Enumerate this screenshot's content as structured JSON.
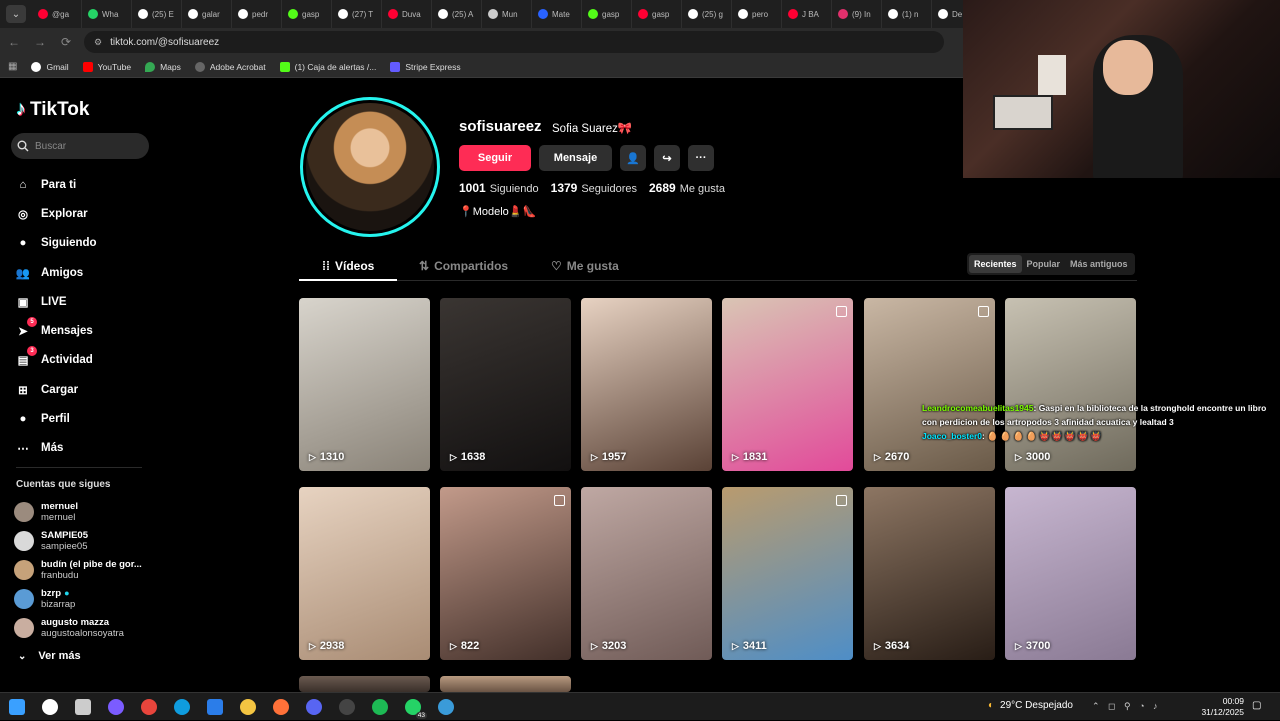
{
  "browser": {
    "tabs": [
      "@ga",
      "Wha",
      "(25) E",
      "galar",
      "pedr",
      "gasp",
      "(27) T",
      "Duva",
      "(25) A",
      "Mun",
      "Mate",
      "gasp",
      "gasp",
      "(25) g",
      "pero",
      "J BA",
      "(9) In",
      "(1) n",
      "De"
    ],
    "url": "tiktok.com/@sofisuareez",
    "bookmarks": [
      "Gmail",
      "YouTube",
      "Maps",
      "Adobe Acrobat",
      "(1) Caja de alertas /...",
      "Stripe Express"
    ]
  },
  "sidebar": {
    "logo": "TikTok",
    "search_placeholder": "Buscar",
    "nav": [
      {
        "label": "Para ti",
        "icon": "home-icon"
      },
      {
        "label": "Explorar",
        "icon": "compass-icon"
      },
      {
        "label": "Siguiendo",
        "icon": "following-icon"
      },
      {
        "label": "Amigos",
        "icon": "friends-icon"
      },
      {
        "label": "LIVE",
        "icon": "live-icon"
      },
      {
        "label": "Mensajes",
        "icon": "messages-icon",
        "badge": "5"
      },
      {
        "label": "Actividad",
        "icon": "activity-icon",
        "badge": "3"
      },
      {
        "label": "Cargar",
        "icon": "upload-icon"
      },
      {
        "label": "Perfil",
        "icon": "profile-icon"
      },
      {
        "label": "Más",
        "icon": "more-icon"
      }
    ],
    "following_title": "Cuentas que sigues",
    "following": [
      {
        "name": "mernuel",
        "user": "mernuel"
      },
      {
        "name": "SAMPIE05",
        "user": "sampiee05"
      },
      {
        "name": "budín (el pibe de gor...",
        "user": "franbudu"
      },
      {
        "name": "bzrp",
        "user": "bizarrap"
      },
      {
        "name": "augusto mazza",
        "user": "augustoalonsoyatra"
      }
    ],
    "see_more": "Ver más"
  },
  "profile": {
    "username": "sofisuareez",
    "display_name": "Sofia Suarez🎀",
    "follow_label": "Seguir",
    "message_label": "Mensaje",
    "following_count": "1001",
    "following_label": "Siguiendo",
    "followers_count": "1379",
    "followers_label": "Seguidores",
    "likes_count": "2689",
    "likes_label": "Me gusta",
    "bio": "📍Modelo💄👠"
  },
  "tabs": {
    "videos": "Vídeos",
    "shared": "Compartidos",
    "liked": "Me gusta"
  },
  "sort": [
    "Recientes",
    "Popular",
    "Más antiguos"
  ],
  "videos": [
    {
      "views": "1310",
      "colors": [
        "#d8d4cc",
        "#8a8378"
      ]
    },
    {
      "views": "1638",
      "colors": [
        "#3a3532",
        "#121010"
      ]
    },
    {
      "views": "1957",
      "colors": [
        "#e7d2c2",
        "#5a4236"
      ]
    },
    {
      "views": "1831",
      "colors": [
        "#d9c5b4",
        "#e24a9a"
      ]
    },
    {
      "views": "2670",
      "colors": [
        "#c9b7a4",
        "#6a5a48"
      ]
    },
    {
      "views": "3000",
      "colors": [
        "#c7c1b2",
        "#6f6a5c"
      ]
    },
    {
      "views": "2938",
      "colors": [
        "#e7d3c1",
        "#a98c74"
      ]
    },
    {
      "views": "822",
      "colors": [
        "#c29a8a",
        "#43302a"
      ]
    },
    {
      "views": "3203",
      "colors": [
        "#bfa8a3",
        "#705b57"
      ]
    },
    {
      "views": "3411",
      "colors": [
        "#b99b6e",
        "#4e8ec7"
      ]
    },
    {
      "views": "3634",
      "colors": [
        "#8d7663",
        "#281d16"
      ]
    },
    {
      "views": "3700",
      "colors": [
        "#c7b6d0",
        "#8a7a94"
      ]
    }
  ],
  "chat": {
    "user1": "Leandrocomeabuelitas1945",
    "msg1": ": Gaspi en la biblioteca de la stronghold encontre un libro con perdicion de los artropodos 3 afinidad acuatica y lealtad 3",
    "user2": "Joaco_boster0",
    "msg2": ": 🥚 🥚 🥚 🥚 👹 👹 👹 👹 👹"
  },
  "taskbar": {
    "weather": "29°C  Despejado",
    "time": "00:09",
    "date": "31/12/2025",
    "whatsapp_badge": "43"
  }
}
